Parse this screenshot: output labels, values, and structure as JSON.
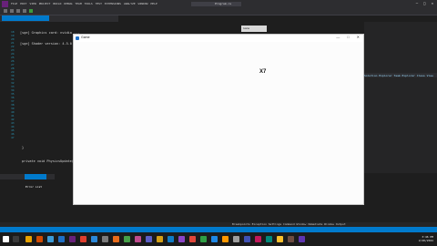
{
  "ide": {
    "menu": [
      "FILE",
      "EDIT",
      "VIEW",
      "PROJECT",
      "BUILD",
      "DEBUG",
      "TEAM",
      "TOOLS",
      "TEST",
      "EXTENSIONS",
      "ANALYZE",
      "WINDOW",
      "HELP"
    ],
    "project_name": "Program.cs",
    "tab_label": "Program.cs",
    "console_lines": [
      "[sge] Graphics card: nvidia ...",
      "[sge] Shader version: 4.5.0 NVIDIA 4..."
    ],
    "line_numbers": [
      "18",
      "19",
      "20",
      "21",
      "22",
      "23",
      "24",
      "25",
      "26",
      "27",
      "28",
      "29",
      "30",
      "31",
      "32",
      "33",
      "34",
      "35",
      "36",
      "37",
      "38",
      "39",
      "40",
      "41",
      "42",
      "43",
      "44",
      "45",
      "46",
      "47"
    ],
    "code": {
      "l1": "}",
      "l2": "private void PhysicsUpdate(...)",
      "l3": "    // check if in bounds",
      "l4": "    if (ball.Bounds.Intersects(...))",
      "l5": "        score_ext++;",
      "l6": "        paddle.Reset();"
    },
    "right_tabs": "Solution Explorer   Team Explorer   Class View",
    "dock_label": "Game"
  },
  "panels": {
    "error_list_label": "Error List",
    "bottom_tabs": "Breakpoints   Exception Settings   Command Window   Immediate Window   Output"
  },
  "game": {
    "title": "Game",
    "minimize": "—",
    "maximize": "□",
    "close": "✕",
    "score": "X7"
  },
  "taskbar": {
    "time": "3:46 PM",
    "date": "2/20/2024"
  },
  "colors": {
    "accent": "#007acc",
    "editor_bg": "#1e1e1e"
  }
}
